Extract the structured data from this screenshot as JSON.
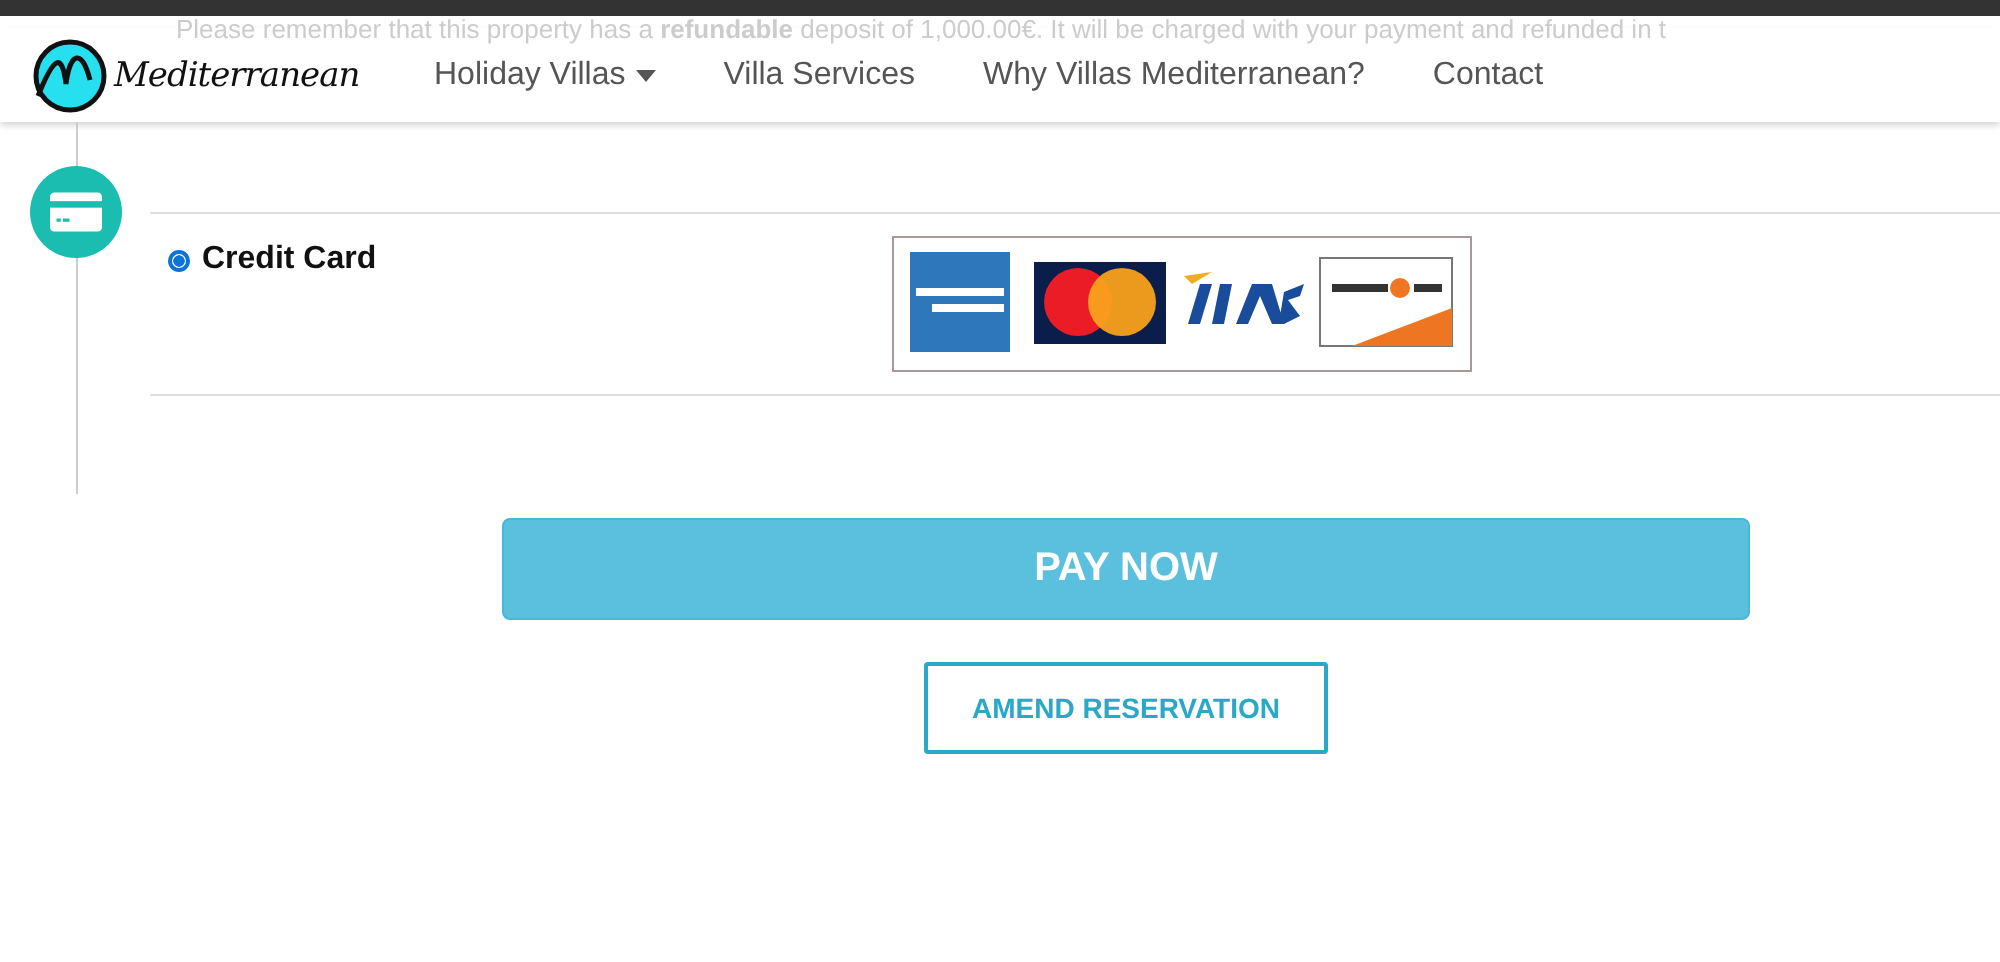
{
  "notice": "Please remember that this property has a **refundable** deposit of 1,000.00€. It will be charged with your payment and refunded in t",
  "logo": {
    "text": "Mediterranean"
  },
  "nav": [
    {
      "label": "Holiday Villas",
      "dropdown": true
    },
    {
      "label": "Villa Services",
      "dropdown": false
    },
    {
      "label": "Why Villas Mediterranean?",
      "dropdown": false
    },
    {
      "label": "Contact",
      "dropdown": false
    }
  ],
  "payment_options": [
    {
      "label": "Credit Card",
      "selected": true
    }
  ],
  "buttons": {
    "pay": "PAY NOW",
    "amend": "AMEND RESERVATION"
  }
}
